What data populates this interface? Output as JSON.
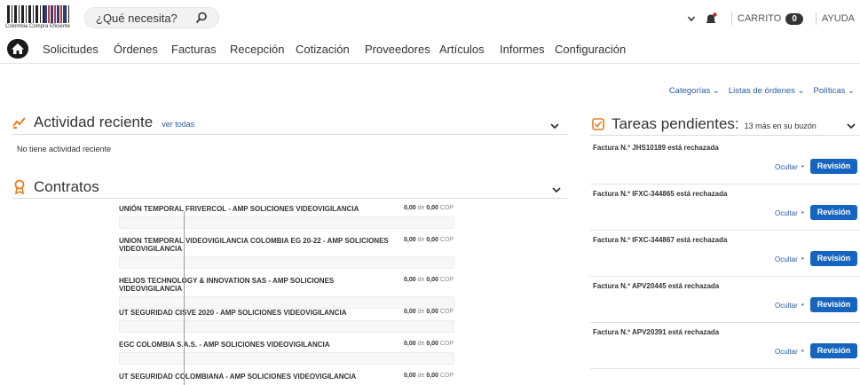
{
  "header": {
    "logo_caption": "Colombia Compra Eficiente",
    "search_placeholder": "¿Qué necesita?",
    "cart_label": "CARRITO",
    "cart_count": "0",
    "help_label": "AYUDA"
  },
  "nav": {
    "items": [
      "Solicitudes",
      "Órdenes",
      "Facturas",
      "Recepción",
      "Cotización",
      "Proveedores",
      "Artículos",
      "Informes",
      "Configuración"
    ]
  },
  "submenu": {
    "items": [
      "Categorías ⌄",
      "Listas de órdenes ⌄",
      "Políticas ⌄"
    ]
  },
  "activity": {
    "title": "Actividad reciente",
    "link": "ver todas",
    "empty": "No tiene actividad reciente"
  },
  "contracts": {
    "title": "Contratos",
    "items": [
      {
        "name": "UNIÓN TEMPORAL FRIVERCOL - AMP SOLICIONES VIDEOVIGILANCIA",
        "amount": "0,00",
        "of": "de",
        "total": "0,00",
        "currency": "COP"
      },
      {
        "name": "UNION TEMPORAL VIDEOVIGILANCIA COLOMBIA EG 20-22 - AMP SOLICIONES VIDEOVIGILANCIA",
        "amount": "0,00",
        "of": "de",
        "total": "0,00",
        "currency": "COP"
      },
      {
        "name": "HELIOS TECHNOLOGY & INNOVATION SAS - AMP SOLICIONES VIDEOVIGILANCIA",
        "amount": "0,00",
        "of": "de",
        "total": "0,00",
        "currency": "COP"
      },
      {
        "name": "UT SEGURIDAD CISVE 2020 - AMP SOLICIONES VIDEOVIGILANCIA",
        "amount": "0,00",
        "of": "de",
        "total": "0,00",
        "currency": "COP"
      },
      {
        "name": "EGC COLOMBIA S.A.S. - AMP SOLICIONES VIDEOVIGILANCIA",
        "amount": "0,00",
        "of": "de",
        "total": "0,00",
        "currency": "COP"
      },
      {
        "name": "UT SEGURIDAD COLOMBIANA - AMP SOLICIONES VIDEOVIGILANCIA",
        "amount": "0,00",
        "of": "de",
        "total": "0,00",
        "currency": "COP"
      }
    ]
  },
  "tasks": {
    "title": "Tareas pendientes:",
    "more": "13 más en su buzón",
    "hide_label": "Ocultar",
    "dot": "•",
    "review_label": "Revisión",
    "items": [
      "Factura N.º JHS10189 está rechazada",
      "Factura N.º IFXC-344865 está rechazada",
      "Factura N.º IFXC-344867 está rechazada",
      "Factura N.º APV20445 está rechazada",
      "Factura N.º APV20391 está rechazada"
    ]
  },
  "colors": {
    "accent": "#1565c0",
    "link": "#2a5a9e"
  }
}
